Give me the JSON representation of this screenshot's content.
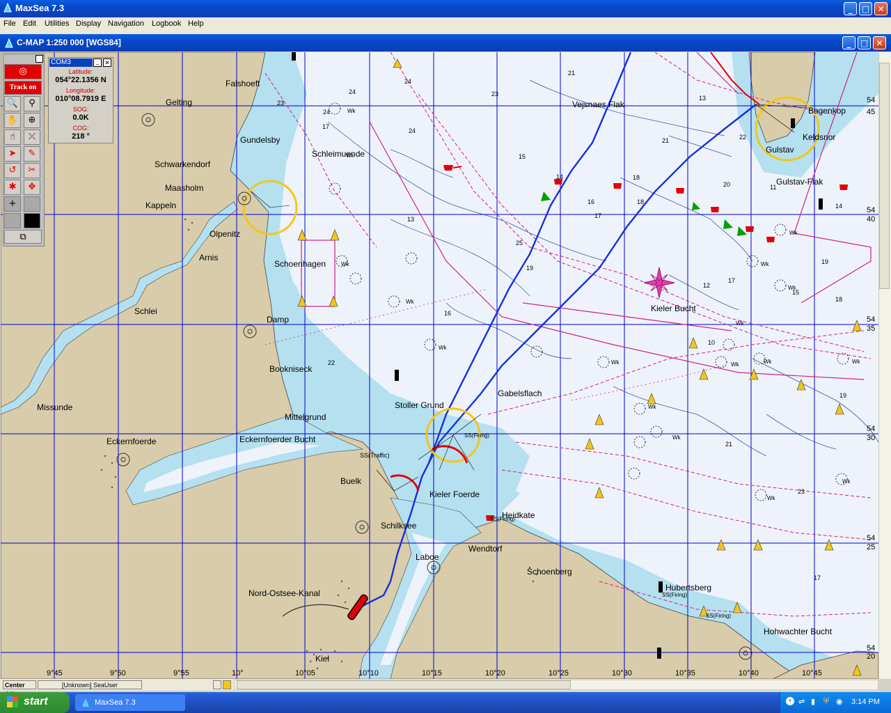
{
  "app_title": "MaxSea 7.3",
  "menu": [
    "File",
    "Edit",
    "Utilities",
    "Display",
    "Navigation",
    "Logbook",
    "Help"
  ],
  "chart_window_title": "C-MAP  1:250 000 [WGS84]",
  "toolbox": {
    "track_label": "Track on"
  },
  "nav_panel": {
    "port": "COM3",
    "latitude_label": "Latitude:",
    "latitude": "054°22.1356 N",
    "longitude_label": "Longitude:",
    "longitude": "010°08.7919 E",
    "sog_label": "SOG:",
    "sog": "0.0K",
    "cog_label": "COG:",
    "cog": "218 °"
  },
  "place_names": [
    "Falshoeft",
    "Gelting",
    "Gundelsby",
    "Schwarkendorf",
    "Maasholm",
    "Kappeln",
    "Olpenitz",
    "Arnis",
    "Schleimuende",
    "Schoenhagen",
    "Schlei",
    "Damp",
    "Bookniseck",
    "Missunde",
    "Eckernfoerde",
    "Eckernfoerder Bucht",
    "Mittelgrund",
    "Stoller Grund",
    "Gabelsflach",
    "Buelk",
    "Kieler Foerde",
    "Heidkate",
    "Schilksee",
    "Laboe",
    "Wendtorf",
    "Schoenberg",
    "Nord-Ostsee-Kanal",
    "Kiel",
    "Kieler Bucht",
    "Vejsnaes Flak",
    "Bagenkop",
    "Keldsnor",
    "Gulstav",
    "Gulstav-Flak",
    "Hubertsberg",
    "Hohwachter Bucht"
  ],
  "lon_labels": [
    "9°45",
    "9°50",
    "9°55",
    "10°",
    "10°05",
    "10°10",
    "10°15",
    "10°20",
    "10°25",
    "10°30",
    "10°35",
    "10°40",
    "10°45"
  ],
  "lat_labels": [
    "54",
    "45",
    "54",
    "40",
    "54",
    "35",
    "54",
    "30",
    "54",
    "25",
    "54",
    "20"
  ],
  "depths": [
    "24",
    "24",
    "23",
    "17",
    "24",
    "13",
    "23",
    "21",
    "24",
    "15",
    "18",
    "21",
    "14",
    "16",
    "18",
    "13",
    "20",
    "22",
    "19",
    "17",
    "11",
    "12",
    "15",
    "16",
    "19",
    "10",
    "14",
    "17",
    "22",
    "18",
    "25",
    "21",
    "23",
    "19",
    "17"
  ],
  "wreck_label": "Wk",
  "traffic_label": "SS(Traffic)",
  "firing_label": "SS(Firing)",
  "status": {
    "center_off": "Center Off",
    "user": "[Unknown]  SeaUser"
  },
  "taskbar": {
    "start": "start",
    "task": "MaxSea 7.3",
    "clock": "3:14 PM"
  },
  "colors": {
    "land": "#d8ccaa",
    "shallow": "#b4e0f0",
    "deep": "#eef3fb",
    "grid": "#0000cc",
    "route": "#1530dd",
    "xp_blue": "#0847c9"
  }
}
